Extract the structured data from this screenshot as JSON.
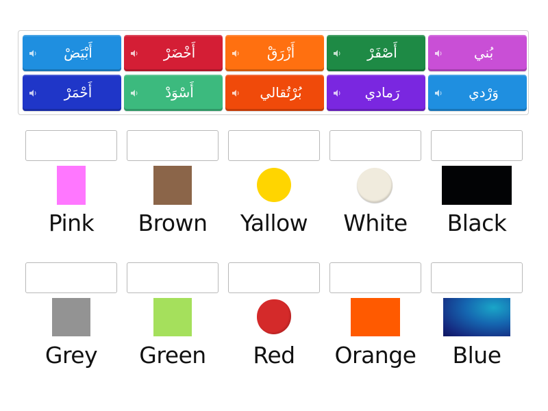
{
  "word_bank": {
    "tiles": [
      {
        "word": "أَبْيَضْ",
        "color": "#1f8fe0",
        "icon": "speaker-icon"
      },
      {
        "word": "أَخْضَرْ",
        "color": "#d41e35",
        "icon": "speaker-icon"
      },
      {
        "word": "أَزْرَقْ",
        "color": "#ff7010",
        "icon": "speaker-icon"
      },
      {
        "word": "أَصْفَرْ",
        "color": "#1e8a45",
        "icon": "speaker-icon"
      },
      {
        "word": "بُني",
        "color": "#c94fd6",
        "icon": "speaker-icon"
      },
      {
        "word": "أَحْمَرْ",
        "color": "#1f36c8",
        "icon": "speaker-icon"
      },
      {
        "word": "أَسْوَدْ",
        "color": "#3cba7e",
        "icon": "speaker-icon"
      },
      {
        "word": "بُرْتُقالي",
        "color": "#f04a0a",
        "icon": "speaker-icon"
      },
      {
        "word": "رَمادي",
        "color": "#7a27e0",
        "icon": "speaker-icon"
      },
      {
        "word": "وَرْدي",
        "color": "#1f8fe0",
        "icon": "speaker-icon"
      }
    ]
  },
  "targets": [
    {
      "label": "Pink",
      "drop_value": "",
      "swatch": {
        "shape": "rect",
        "color": "#ff77ff"
      }
    },
    {
      "label": "Brown",
      "drop_value": "",
      "swatch": {
        "shape": "rect",
        "color": "#8b6549"
      }
    },
    {
      "label": "Yallow",
      "drop_value": "",
      "swatch": {
        "shape": "circle",
        "color": "#ffd500"
      }
    },
    {
      "label": "White",
      "drop_value": "",
      "swatch": {
        "shape": "circle",
        "color": "#f0ebdd"
      }
    },
    {
      "label": "Black",
      "drop_value": "",
      "swatch": {
        "shape": "rect",
        "color": "#020305"
      }
    },
    {
      "label": "Grey",
      "drop_value": "",
      "swatch": {
        "shape": "rect",
        "color": "#939393"
      }
    },
    {
      "label": "Green",
      "drop_value": "",
      "swatch": {
        "shape": "rect",
        "color": "#a5e05c"
      }
    },
    {
      "label": "Red",
      "drop_value": "",
      "swatch": {
        "shape": "circle",
        "color": "#d42a2a"
      }
    },
    {
      "label": "Orange",
      "drop_value": "",
      "swatch": {
        "shape": "rect",
        "color": "#ff5a00"
      }
    },
    {
      "label": "Blue",
      "drop_value": "",
      "swatch": {
        "shape": "rect",
        "color": "#1a5fae"
      }
    }
  ]
}
